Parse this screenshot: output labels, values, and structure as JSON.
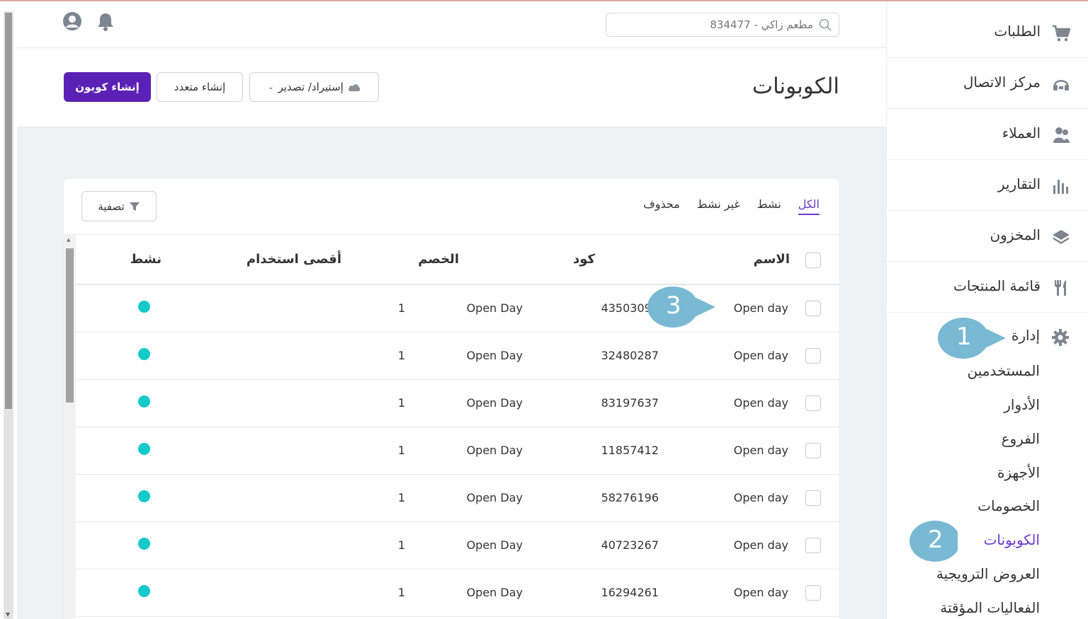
{
  "topbar": {
    "search_placeholder": "مطعم زاكي - 834477",
    "search_icon": "search-icon",
    "bell_icon": "bell-icon",
    "user_icon": "user-circle-icon"
  },
  "header": {
    "title": "الكوبونات",
    "create_coupon_label": "إنشاء كوبون",
    "create_multiple_label": "إنشاء متعدد",
    "import_export_label": "إستيراد/ تصدير"
  },
  "filters": {
    "tabs": [
      "الكل",
      "نشط",
      "غير نشط",
      "محذوف"
    ],
    "active_tab": "الكل",
    "filter_label": "تصفية"
  },
  "table": {
    "headers": {
      "name": "الاسم",
      "code": "كود",
      "discount": "الخصم",
      "max_usage": "أقصى استخدام",
      "active": "نشط"
    },
    "rows": [
      {
        "name": "Open day",
        "code": "43503091",
        "discount": "Open Day",
        "max_usage": "1",
        "active": true
      },
      {
        "name": "Open day",
        "code": "32480287",
        "discount": "Open Day",
        "max_usage": "1",
        "active": true
      },
      {
        "name": "Open day",
        "code": "83197637",
        "discount": "Open Day",
        "max_usage": "1",
        "active": true
      },
      {
        "name": "Open day",
        "code": "11857412",
        "discount": "Open Day",
        "max_usage": "1",
        "active": true
      },
      {
        "name": "Open day",
        "code": "58276196",
        "discount": "Open Day",
        "max_usage": "1",
        "active": true
      },
      {
        "name": "Open day",
        "code": "40723267",
        "discount": "Open Day",
        "max_usage": "1",
        "active": true
      },
      {
        "name": "Open day",
        "code": "16294261",
        "discount": "Open Day",
        "max_usage": "1",
        "active": true
      }
    ]
  },
  "sidebar": {
    "items": [
      {
        "label": "الطلبات",
        "icon": "cart-icon"
      },
      {
        "label": "مركز الاتصال",
        "icon": "headset-icon"
      },
      {
        "label": "العملاء",
        "icon": "users-icon"
      },
      {
        "label": "التقارير",
        "icon": "bar-chart-icon"
      },
      {
        "label": "المخزون",
        "icon": "layers-icon"
      },
      {
        "label": "قائمة المنتجات",
        "icon": "fork-knife-icon"
      }
    ],
    "admin_label": "إدارة",
    "admin_icon": "gear-icon",
    "sub_items": [
      "المستخدمين",
      "الأدوار",
      "الفروع",
      "الأجهزة",
      "الخصومات",
      "الكوبونات",
      "العروض الترويجية",
      "الفعاليات المؤقتة"
    ],
    "active_sub": "الكوبونات"
  },
  "callouts": [
    "1",
    "2",
    "3"
  ],
  "colors": {
    "primary": "#5b21b6",
    "active_link": "#6d3bd1",
    "status_active": "#14c9c9",
    "callout": "#79b9d3"
  }
}
